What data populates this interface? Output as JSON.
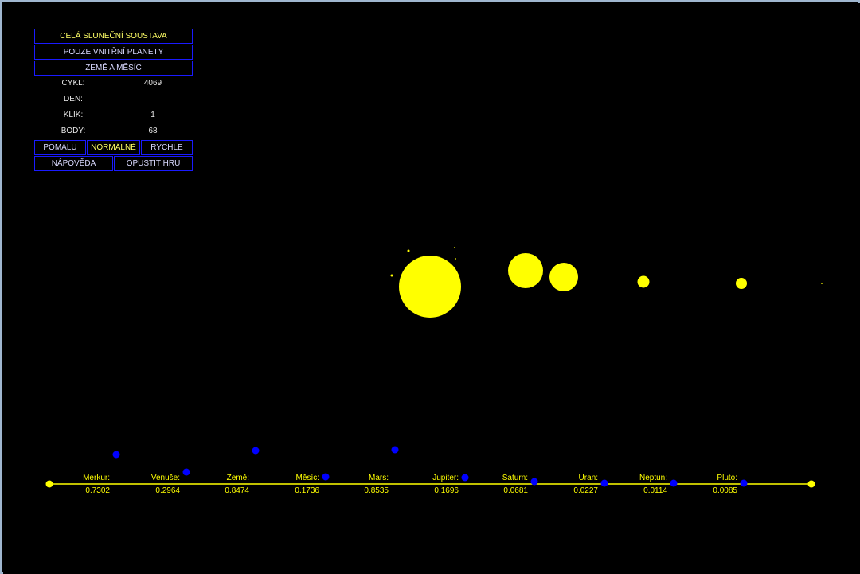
{
  "menu": {
    "whole_system": "CELÁ SLUNEČNÍ SOUSTAVA",
    "inner_planets": "POUZE VNITŘNÍ PLANETY",
    "earth_moon": "ZEMĚ A MĚSÍC"
  },
  "stats": {
    "cycle_label": "CYKL:",
    "cycle_value": "4069",
    "day_label": "DEN:",
    "day_value": "",
    "click_label": "KLIK:",
    "click_value": "1",
    "points_label": "BODY:",
    "points_value": "68"
  },
  "speed": {
    "slow": "POMALU",
    "normal": "NORMÁLNĚ",
    "fast": "RYCHLE",
    "selected": "normal"
  },
  "actions": {
    "help": "NÁPOVĚDA",
    "quit": "OPUSTIT HRU"
  },
  "colors": {
    "background": "#000000",
    "bodies": "#ffff00",
    "button_border": "#1a1aff",
    "slider_knob": "#0000ff",
    "slider_track": "#ffff00"
  },
  "sliders": [
    {
      "label": "Merkur:",
      "value": "0.7302"
    },
    {
      "label": "Venuše:",
      "value": "0.2964"
    },
    {
      "label": "Země:",
      "value": "0.8474"
    },
    {
      "label": "Měsíc:",
      "value": "0.1736"
    },
    {
      "label": "Mars:",
      "value": "0.8535"
    },
    {
      "label": "Jupiter:",
      "value": "0.1696"
    },
    {
      "label": "Saturn:",
      "value": "0.0681"
    },
    {
      "label": "Uran:",
      "value": "0.0227"
    },
    {
      "label": "Neptun:",
      "value": "0.0114"
    },
    {
      "label": "Pluto:",
      "value": "0.0085"
    }
  ]
}
